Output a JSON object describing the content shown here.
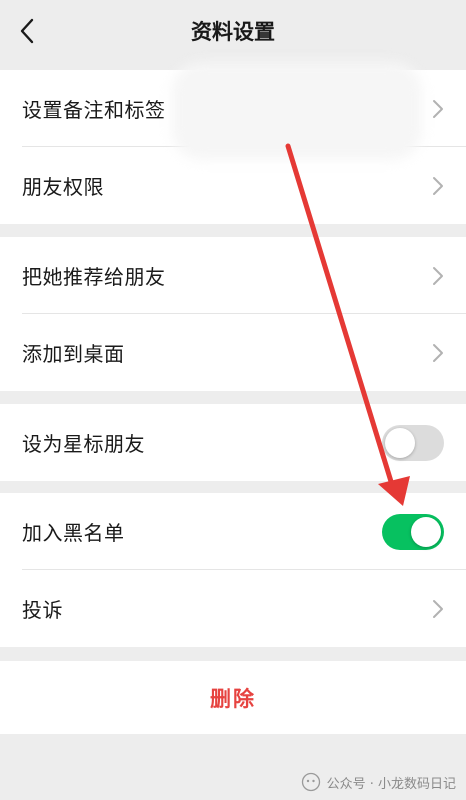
{
  "header": {
    "title": "资料设置"
  },
  "groups": [
    {
      "rows": [
        {
          "label": "设置备注和标签"
        },
        {
          "label": "朋友权限"
        }
      ]
    },
    {
      "rows": [
        {
          "label": "把她推荐给朋友"
        },
        {
          "label": "添加到桌面"
        }
      ]
    },
    {
      "rows": [
        {
          "label": "设为星标朋友",
          "toggle": "off"
        }
      ]
    },
    {
      "rows": [
        {
          "label": "加入黑名单",
          "toggle": "on"
        },
        {
          "label": "投诉"
        }
      ]
    }
  ],
  "delete": {
    "label": "删除"
  },
  "watermark": {
    "text": "公众号 · 小龙数码日记"
  },
  "colors": {
    "background": "#ededed",
    "toggle_on": "#07c160",
    "toggle_off": "#dcdcdc",
    "delete_red": "#e64340",
    "arrow_red": "#e53935"
  },
  "icons": {
    "back": "chevron-left-icon",
    "row_arrow": "chevron-right-icon"
  }
}
